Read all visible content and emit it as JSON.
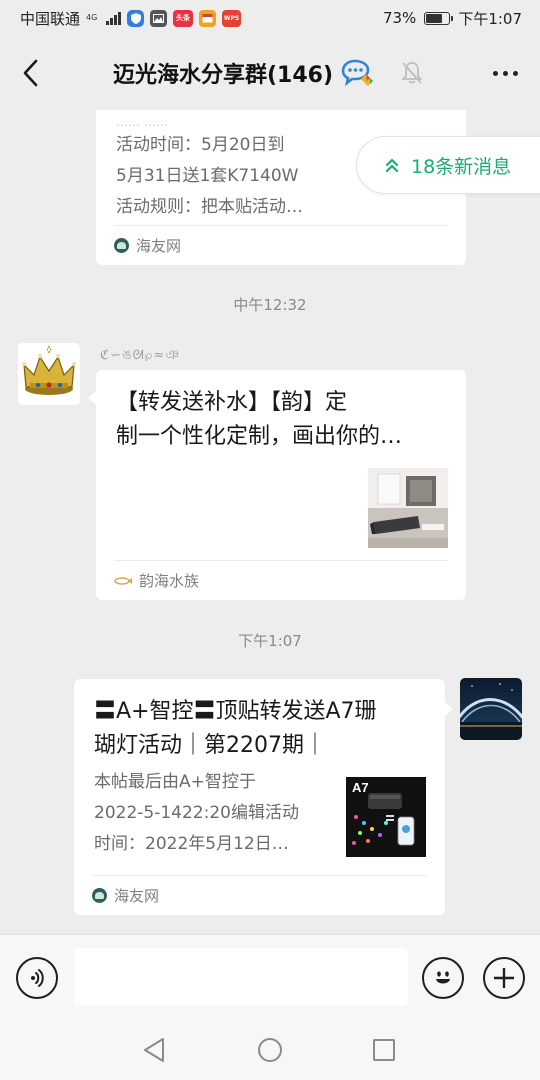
{
  "status_bar": {
    "carrier": "中国联通",
    "network": "4G",
    "app_badge_1": "头条",
    "app_badge_2": "WPS",
    "battery": "73%",
    "time": "下午1:07",
    "battery_level": 0.73
  },
  "header": {
    "title": "迈光海水分享群(146)",
    "back_icon": "chevron-left-icon",
    "more_icon": "more-dots-icon"
  },
  "new_messages": {
    "label": "18条新消息",
    "icon": "double-chevron-up-icon"
  },
  "messages": [
    {
      "type": "link-card",
      "sender_side": "left",
      "desc_lines": [
        "活动时间：5月20日到",
        "5月31日送1套K7140W",
        "活动规则：把本贴活动…"
      ],
      "source": "海友网"
    },
    {
      "type": "timestamp",
      "text": "中午12:32"
    },
    {
      "type": "link-card",
      "sender_side": "left",
      "sender_name_decorative": "ℭ∽ঙᘛ℘≈ঞ",
      "title_lines": [
        "【转发送补水】【韵】定",
        "制一个性化定制，画出你的…"
      ],
      "source": "韵海水族"
    },
    {
      "type": "timestamp",
      "text": "下午1:07"
    },
    {
      "type": "link-card",
      "sender_side": "right",
      "title_lines": [
        "〓A+智控〓顶贴转发送A7珊",
        "瑚灯活动｜第2207期｜"
      ],
      "desc_lines": [
        "本帖最后由A+智控于",
        "2022-5-1422:20编辑活动",
        "时间：2022年5月12日…"
      ],
      "thumb_label": "A7",
      "source": "海友网"
    }
  ],
  "input_bar": {
    "placeholder": "",
    "voice_icon": "voice-icon",
    "emoji_icon": "emoji-icon",
    "plus_icon": "plus-icon"
  },
  "system_nav": {
    "back_icon": "triangle-back-icon",
    "home_icon": "circle-home-icon",
    "recents_icon": "square-recents-icon"
  },
  "colors": {
    "accent": "#1aad6f",
    "background": "#ededed",
    "bubble": "#ffffff"
  }
}
